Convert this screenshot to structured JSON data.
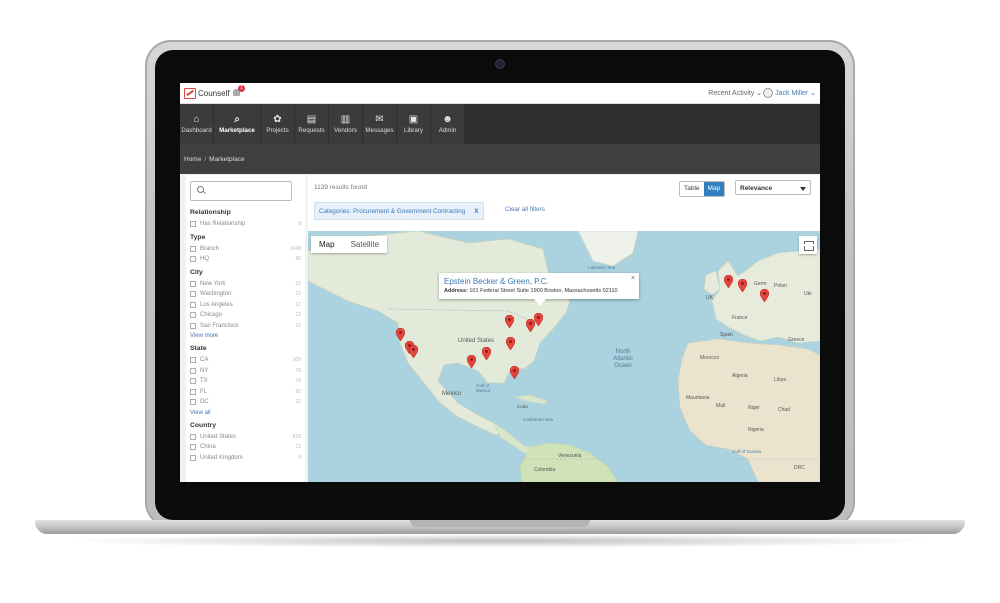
{
  "app": {
    "brand": "Counself",
    "notifications": "1"
  },
  "topbar": {
    "recent_activity": "Recent Activity ⌄",
    "user_name": "Jack Miller ⌄"
  },
  "nav": [
    {
      "label": "Dashboard",
      "icon": "home-icon",
      "glyph": "⌂"
    },
    {
      "label": "Marketplace",
      "icon": "search-icon",
      "glyph": "⌕"
    },
    {
      "label": "Projects",
      "icon": "cluster-icon",
      "glyph": "✿"
    },
    {
      "label": "Requests",
      "icon": "list-icon",
      "glyph": "▤"
    },
    {
      "label": "Vendors",
      "icon": "bank-icon",
      "glyph": "▥"
    },
    {
      "label": "Messages",
      "icon": "envelope-icon",
      "glyph": "✉"
    },
    {
      "label": "Library",
      "icon": "briefcase-icon",
      "glyph": "▣"
    },
    {
      "label": "Admin",
      "icon": "users-icon",
      "glyph": "☻"
    }
  ],
  "breadcrumb": {
    "home": "Home",
    "separator": "/",
    "current": "Marketplace"
  },
  "filters": {
    "relationship": {
      "title": "Relationship",
      "items": [
        {
          "label": "Has Relationship",
          "count": "8"
        }
      ]
    },
    "type": {
      "title": "Type",
      "items": [
        {
          "label": "Branch",
          "count": "1048"
        },
        {
          "label": "HQ",
          "count": "96"
        }
      ]
    },
    "city": {
      "title": "City",
      "items": [
        {
          "label": "New York",
          "count": "22"
        },
        {
          "label": "Washington",
          "count": "12"
        },
        {
          "label": "Los Angeles",
          "count": "12"
        },
        {
          "label": "Chicago",
          "count": "12"
        },
        {
          "label": "San Francisco",
          "count": "10"
        }
      ],
      "more": "View more"
    },
    "state": {
      "title": "State",
      "items": [
        {
          "label": "CA",
          "count": "108"
        },
        {
          "label": "NY",
          "count": "79"
        },
        {
          "label": "TX",
          "count": "79"
        },
        {
          "label": "FL",
          "count": "60"
        },
        {
          "label": "DC",
          "count": "12"
        }
      ],
      "more": "View all"
    },
    "country": {
      "title": "Country",
      "items": [
        {
          "label": "United States",
          "count": "828"
        },
        {
          "label": "China",
          "count": "12"
        },
        {
          "label": "United Kingdom",
          "count": "9"
        }
      ]
    }
  },
  "results": {
    "count_text": "1139 results found"
  },
  "view_toggle": {
    "table": "Table",
    "map": "Map"
  },
  "sort": {
    "selected": "Relevance"
  },
  "active_filter": {
    "label": "Categories: Procurement & Government Contracting",
    "remove": "X"
  },
  "clear_filters": "Clear all filters",
  "map": {
    "type_map": "Map",
    "type_satellite": "Satellite",
    "infowindow": {
      "name": "Epstein Becker & Green, P.C.",
      "address_label": "Address:",
      "address": "101 Federal Street Suite 1900 Boston, Massachusetts 02110",
      "close": "×"
    },
    "labels": {
      "atlantic": "North Atlantic Ocean",
      "gulf": "Gulf of Mexico",
      "caribbean": "Caribbean Sea",
      "us": "United States",
      "mexico": "Mexico",
      "cuba": "Cuba",
      "labrador": "Labrador Sea",
      "guinea": "Gulf of Guinea",
      "uk": "UK",
      "france": "France",
      "spain": "Spain",
      "algeria": "Algeria",
      "libya": "Libya",
      "mali": "Mali",
      "niger": "Niger",
      "chad": "Chad",
      "nigeria": "Nigeria",
      "morocco": "Morocco",
      "mauritania": "Mauritania",
      "drc": "DRC",
      "greece": "Greece",
      "germany": "Germ",
      "ukraine": "Ukr",
      "poland": "Polan",
      "venezuela": "Venezuela",
      "colombia": "Colombia"
    }
  }
}
